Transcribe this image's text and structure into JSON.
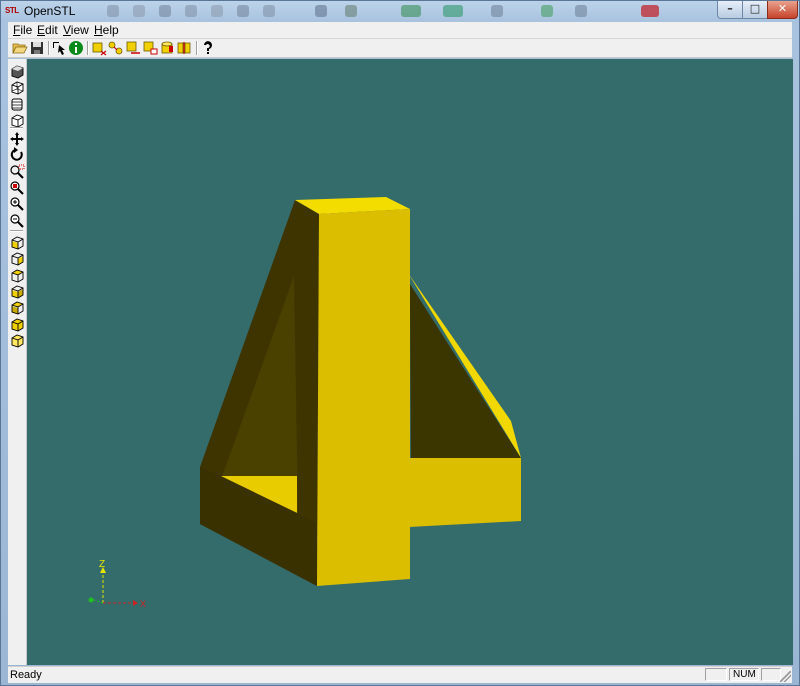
{
  "window": {
    "logo_text": "STL",
    "title": "OpenSTL",
    "caption_buttons": {
      "minimize": "–",
      "maximize": "□",
      "close": "✕"
    }
  },
  "menubar": {
    "items": [
      {
        "label": "File",
        "mnemonic": "F",
        "rest": "ile"
      },
      {
        "label": "Edit",
        "mnemonic": "E",
        "rest": "dit"
      },
      {
        "label": "View",
        "mnemonic": "V",
        "rest": "iew"
      },
      {
        "label": "Help",
        "mnemonic": "H",
        "rest": "elp"
      }
    ]
  },
  "toolbar": {
    "buttons": [
      {
        "name": "open-icon"
      },
      {
        "name": "save-icon"
      },
      {
        "name": "select-pointer-icon"
      },
      {
        "name": "info-icon"
      },
      {
        "name": "cut-plane-icon"
      },
      {
        "name": "connect-icon"
      },
      {
        "name": "edge-icon"
      },
      {
        "name": "surface-icon"
      },
      {
        "name": "cylinder-icon"
      },
      {
        "name": "slice-icon"
      },
      {
        "name": "help-icon"
      }
    ]
  },
  "left_toolbar": {
    "groups": [
      [
        "shaded-view-icon",
        "wireframe-view-icon",
        "points-view-icon",
        "box-view-icon"
      ],
      [
        "pan-icon",
        "rotate-icon",
        "zoom-window-icon",
        "zoom-fit-icon",
        "zoom-in-icon",
        "zoom-out-icon"
      ],
      [
        "front-view-icon",
        "back-view-icon",
        "left-view-icon",
        "right-view-icon",
        "top-view-icon",
        "bottom-view-icon",
        "iso-view-icon"
      ]
    ]
  },
  "viewport": {
    "background": "#346b6b",
    "model_color": "#dcbe00",
    "axes": {
      "z_label": "Z",
      "x_label": "X",
      "z_color": "#e6e600",
      "x_color": "#d02020",
      "y_color": "#20c020"
    }
  },
  "statusbar": {
    "status": "Ready",
    "panes": [
      "",
      "NUM",
      ""
    ]
  }
}
